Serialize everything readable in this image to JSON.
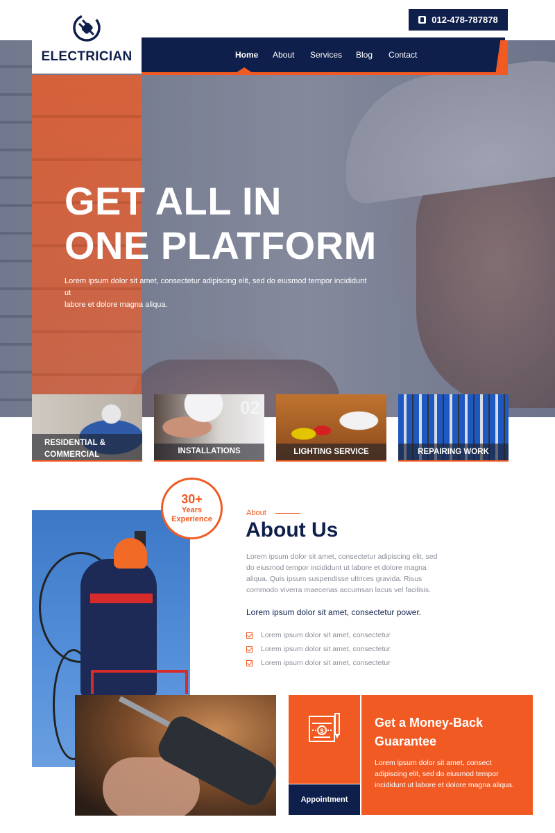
{
  "brand": {
    "name": "ELECTRICIAN",
    "logo_icon": "plug-icon"
  },
  "header": {
    "phone": "012-478-787878",
    "phone_icon": "phone-icon"
  },
  "nav": {
    "items": [
      "Home",
      "About",
      "Services",
      "Blog",
      "Contact"
    ],
    "active": "Home"
  },
  "hero": {
    "title_line1": "GET ALL IN",
    "title_line2": "ONE PLATFORM",
    "description_line1": "Lorem ipsum dolor sit amet, consectetur adipiscing elit, sed do eiusmod tempor incididunt ut",
    "description_line2": "labore et dolore magna aliqua."
  },
  "services": [
    {
      "label_line1": "RESIDENTIAL &",
      "label_line2": "COMMERCIAL",
      "number": ""
    },
    {
      "label_line1": "INSTALLATIONS",
      "label_line2": "",
      "number": "02"
    },
    {
      "label_line1": "LIGHTING SERVICE",
      "label_line2": "",
      "number": ""
    },
    {
      "label_line1": "REPAIRING WORK",
      "label_line2": "",
      "number": ""
    }
  ],
  "badge": {
    "number": "30+",
    "line1": "Years",
    "line2": "Experience"
  },
  "about": {
    "eyebrow": "About",
    "title": "About Us",
    "paragraph": "Lorem ipsum dolor sit amet, consectetur adipiscing elit, sed do eiusmod tempor incididunt ut labore et dolore magna aliqua. Quis ipsum suspendisse ultrices gravida. Risus commodo viverra maecenas accumsan lacus vel facilisis.",
    "strong": "Lorem ipsum dolor sit amet, consectetur power.",
    "checklist": [
      "Lorem ipsum dolor sit amet, consectetur",
      "Lorem ipsum dolor sit amet, consectetur",
      "Lorem ipsum dolor sit amet, consectetur"
    ]
  },
  "guarantee": {
    "title_line1": "Get a Money-Back",
    "title_line2": "Guarantee",
    "description": "Lorem ipsum dolor sit amet, consect adipiscing elit, sed do eiusmod tempor incididunt ut labore et dolore magna aliqua.",
    "appointment_label": "Appointment",
    "icon": "money-check-icon"
  },
  "colors": {
    "navy": "#0f1f4b",
    "orange": "#f15a22",
    "white": "#ffffff",
    "muted_text": "#8a8e99"
  }
}
